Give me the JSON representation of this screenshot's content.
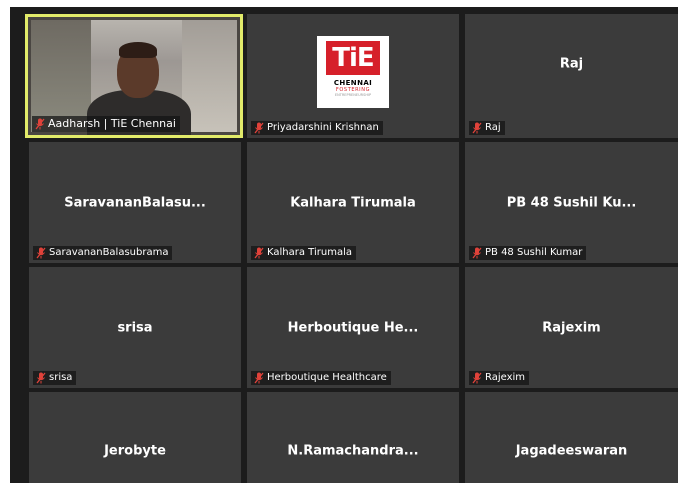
{
  "colors": {
    "active_border": "#e2eb6a",
    "tile_bg": "#3b3b3b",
    "mute_icon": "#e0423a"
  },
  "participants": [
    {
      "name_tag": "Aadharsh | TiE Chennai",
      "center_label": "",
      "video": true,
      "active_speaker": true,
      "muted": true
    },
    {
      "name_tag": "Priyadarshini Krishnan",
      "center_label": "",
      "logo": {
        "mark": "TiE",
        "city": "CHENNAI",
        "sub": "FOSTERING",
        "tiny": "ENTREPRENEURSHIP"
      },
      "muted": true
    },
    {
      "name_tag": "Raj",
      "center_label": "Raj",
      "muted": true
    },
    {
      "name_tag": "SaravananBalasubrama",
      "center_label": "SaravananBalasu...",
      "muted": true
    },
    {
      "name_tag": "Kalhara Tirumala",
      "center_label": "Kalhara Tirumala",
      "muted": true
    },
    {
      "name_tag": "PB 48 Sushil Kumar",
      "center_label": "PB 48 Sushil Ku...",
      "muted": true
    },
    {
      "name_tag": "srisa",
      "center_label": "srisa",
      "muted": true
    },
    {
      "name_tag": "Herboutique Healthcare",
      "center_label": "Herboutique He...",
      "muted": true
    },
    {
      "name_tag": "Rajexim",
      "center_label": "Rajexim",
      "muted": true
    },
    {
      "name_tag": "",
      "center_label": "Jerobyte",
      "muted": false
    },
    {
      "name_tag": "",
      "center_label": "N.Ramachandra...",
      "muted": false
    },
    {
      "name_tag": "",
      "center_label": "Jagadeeswaran",
      "muted": false
    }
  ]
}
